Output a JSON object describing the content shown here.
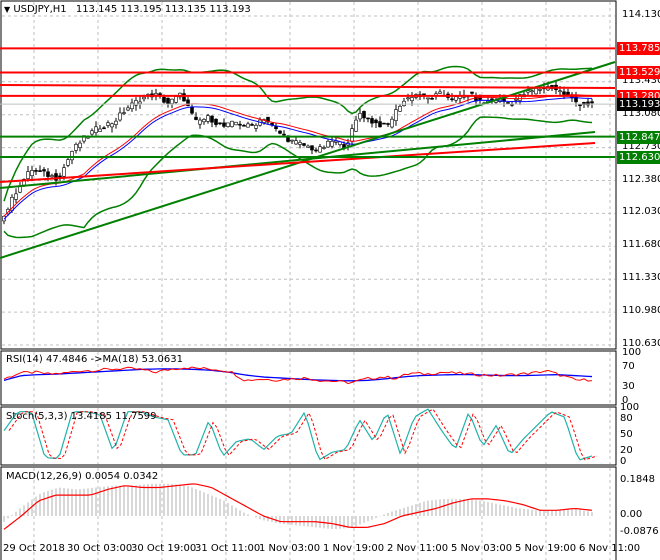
{
  "header": {
    "symbol": "USDJPY,H1",
    "ohlc": "113.145 113.195 113.135 113.193"
  },
  "price_axis": [
    "114.130",
    "113.430",
    "113.080",
    "112.730",
    "112.380",
    "112.030",
    "111.680",
    "111.330",
    "110.980",
    "110.630"
  ],
  "levels": [
    {
      "label": "113.785",
      "value": 113.785,
      "color": "#ff0000"
    },
    {
      "label": "113.529",
      "value": 113.529,
      "color": "#ff0000"
    },
    {
      "label": "113.280",
      "value": 113.28,
      "color": "#ff0000"
    },
    {
      "label": "113.193",
      "value": 113.193,
      "color": "#000000"
    },
    {
      "label": "112.847",
      "value": 112.847,
      "color": "#008000"
    },
    {
      "label": "112.630",
      "value": 112.63,
      "color": "#008000"
    }
  ],
  "rsi": {
    "title": "RSI(14) 47.4846  ->MA(18) 53.0631",
    "ticks": [
      "100",
      "70",
      "30",
      "0"
    ]
  },
  "stoch": {
    "title": "Stoch(5,3,3) 13.4185 11.7599",
    "ticks": [
      "100",
      "80",
      "50",
      "20",
      "0"
    ]
  },
  "macd": {
    "title": "MACD(12,26,9) 0.0054 0.0342",
    "ticks": [
      "0.1848",
      "0.00",
      "-0.0876"
    ]
  },
  "time_axis": [
    "29 Oct 2018",
    "30 Oct 03:00",
    "30 Oct 19:00",
    "31 Oct 11:00",
    "1 Nov 03:00",
    "1 Nov 19:00",
    "2 Nov 11:00",
    "5 Nov 03:00",
    "5 Nov 19:00",
    "6 Nov 11:00"
  ],
  "chart_data": {
    "type": "candlestick",
    "symbol": "USDJPY",
    "timeframe": "H1",
    "ylim": [
      110.63,
      114.13
    ],
    "close_path": [
      112.0,
      112.3,
      112.5,
      112.45,
      112.4,
      112.7,
      112.85,
      112.95,
      113.0,
      113.15,
      113.25,
      113.3,
      113.2,
      113.3,
      113.0,
      113.05,
      112.95,
      113.0,
      112.95,
      113.05,
      112.9,
      112.8,
      112.75,
      112.7,
      112.8,
      112.75,
      113.1,
      113.0,
      112.95,
      113.2,
      113.3,
      113.25,
      113.3,
      113.25,
      113.3,
      113.2,
      113.25,
      113.2,
      113.3,
      113.35,
      113.38,
      113.3,
      113.2,
      113.19
    ],
    "rsi_path": [
      48,
      60,
      62,
      58,
      60,
      65,
      66,
      68,
      70,
      68,
      62,
      68,
      72,
      70,
      68,
      64,
      45,
      48,
      46,
      48,
      50,
      45,
      43,
      40,
      48,
      52,
      50,
      60,
      58,
      62,
      60,
      58,
      56,
      55,
      58,
      60,
      65,
      55,
      45,
      47
    ],
    "rsi_ma_path": [
      45,
      55,
      57,
      58,
      60,
      62,
      64,
      66,
      68,
      69,
      69,
      68,
      66,
      62,
      56,
      52,
      50,
      48,
      46,
      45,
      44,
      45,
      48,
      52,
      55,
      56,
      57,
      57,
      56,
      55,
      55,
      56,
      57,
      55,
      53
    ],
    "stoch_path": [
      60,
      95,
      95,
      10,
      8,
      95,
      95,
      90,
      20,
      95,
      95,
      85,
      80,
      15,
      15,
      80,
      12,
      40,
      45,
      25,
      50,
      55,
      95,
      5,
      20,
      25,
      80,
      40,
      95,
      15,
      85,
      100,
      60,
      25,
      95,
      30,
      70,
      15,
      45,
      70,
      95,
      85,
      5,
      13
    ],
    "macd_hist_path": [
      -0.03,
      0.05,
      0.12,
      0.15,
      0.14,
      0.15,
      0.16,
      0.16,
      0.17,
      0.17,
      0.16,
      0.12,
      0.08,
      0.02,
      -0.02,
      -0.04,
      -0.05,
      -0.06,
      -0.07,
      -0.06,
      -0.02,
      0.02,
      0.05,
      0.08,
      0.09,
      0.09,
      0.08,
      0.06,
      0.04,
      0.03,
      0.03,
      0.04,
      0.02
    ],
    "macd_signal_path": [
      -0.07,
      0.0,
      0.08,
      0.11,
      0.11,
      0.11,
      0.14,
      0.16,
      0.15,
      0.15,
      0.16,
      0.17,
      0.15,
      0.1,
      0.05,
      0.0,
      -0.03,
      -0.03,
      -0.03,
      -0.04,
      -0.06,
      -0.06,
      -0.04,
      0.0,
      0.02,
      0.04,
      0.07,
      0.09,
      0.09,
      0.08,
      0.06,
      0.03,
      0.03,
      0.04,
      0.03
    ]
  }
}
